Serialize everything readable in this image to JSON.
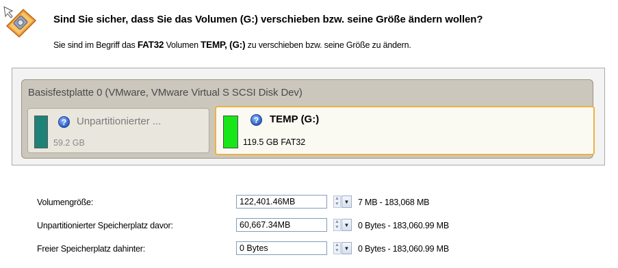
{
  "header": {
    "title": "Sind Sie sicher, dass Sie das Volumen (G:) verschieben bzw. seine Größe ändern wollen?",
    "subtitle_pre": "Sie sind im Begriff das ",
    "subtitle_fs": "FAT32",
    "subtitle_mid": " Volumen ",
    "subtitle_name": "TEMP, (G:)",
    "subtitle_post": " zu verschieben bzw. seine Größe zu ändern."
  },
  "disk": {
    "label": "Basisfestplatte 0 (VMware, VMware Virtual S SCSI Disk Dev)",
    "partitions": [
      {
        "name": "Unpartitionierter ...",
        "info": "59.2 GB",
        "color": "#1f8276",
        "icon": "question-icon"
      },
      {
        "name": "TEMP (G:)",
        "info": "119.5 GB FAT32",
        "color": "#19e619",
        "icon": "question-icon"
      }
    ]
  },
  "fields": [
    {
      "label": "Volumengröße:",
      "value": "122,401.46MB",
      "range": "7 MB - 183,068 MB"
    },
    {
      "label": "Unpartitionierter Speicherplatz davor:",
      "value": "60,667.34MB",
      "range": "0 Bytes - 183,060.99 MB"
    },
    {
      "label": "Freier Speicherplatz dahinter:",
      "value": "0 Bytes",
      "range": "0 Bytes - 183,060.99 MB"
    }
  ],
  "colors": {
    "selected_border": "#f0b040",
    "disk_panel": "#ccc7bd"
  }
}
